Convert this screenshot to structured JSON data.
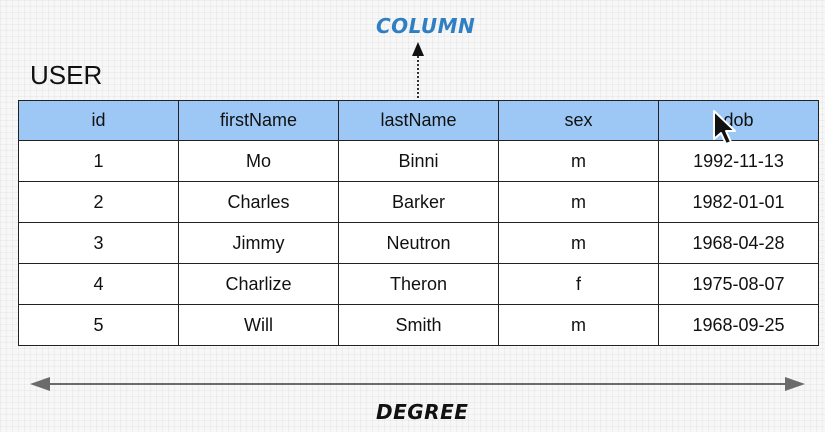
{
  "column_label": "COLUMN",
  "table_title": "USER",
  "headers": [
    "id",
    "firstName",
    "lastName",
    "sex",
    "dob"
  ],
  "rows": [
    [
      "1",
      "Mo",
      "Binni",
      "m",
      "1992-11-13"
    ],
    [
      "2",
      "Charles",
      "Barker",
      "m",
      "1982-01-01"
    ],
    [
      "3",
      "Jimmy",
      "Neutron",
      "m",
      "1968-04-28"
    ],
    [
      "4",
      "Charlize",
      "Theron",
      "f",
      "1975-08-07"
    ],
    [
      "5",
      "Will",
      "Smith",
      "m",
      "1968-09-25"
    ]
  ],
  "degree_label": "DEGREE",
  "colors": {
    "header_bg": "#9dc8f5",
    "column_label": "#2f7fc3",
    "arrow": "#6b6b6b",
    "border": "#222222"
  },
  "icons": {
    "column_arrow": "arrow-up-icon",
    "degree_arrow": "double-arrow-horizontal-icon",
    "cursor": "mouse-pointer-icon"
  }
}
